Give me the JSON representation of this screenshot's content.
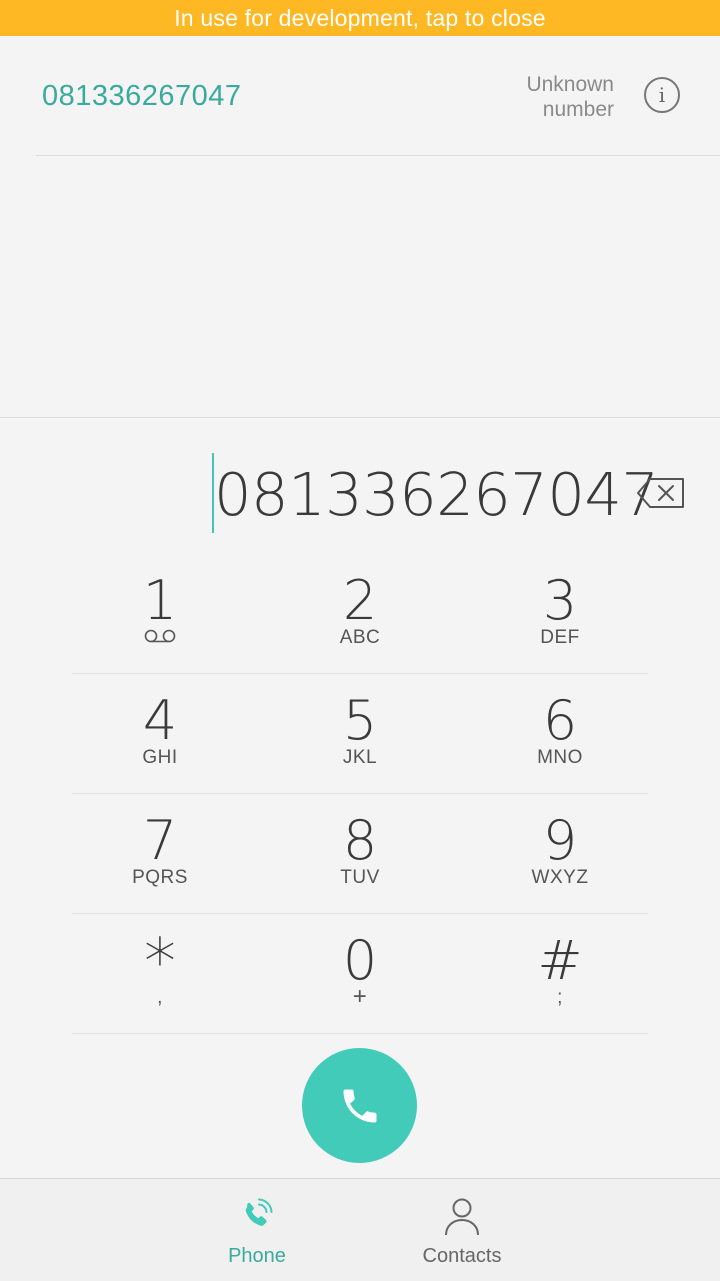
{
  "banner": {
    "text": "In use for development, tap to close"
  },
  "suggestion": {
    "number": "081336267047",
    "label_line1": "Unknown",
    "label_line2": "number",
    "info_glyph": "i"
  },
  "dialer": {
    "dialed_number": "081336267047"
  },
  "keypad": {
    "rows": [
      [
        {
          "digit": "1",
          "letters": ""
        },
        {
          "digit": "2",
          "letters": "ABC"
        },
        {
          "digit": "3",
          "letters": "DEF"
        }
      ],
      [
        {
          "digit": "4",
          "letters": "GHI"
        },
        {
          "digit": "5",
          "letters": "JKL"
        },
        {
          "digit": "6",
          "letters": "MNO"
        }
      ],
      [
        {
          "digit": "7",
          "letters": "PQRS"
        },
        {
          "digit": "8",
          "letters": "TUV"
        },
        {
          "digit": "9",
          "letters": "WXYZ"
        }
      ],
      [
        {
          "digit": "*",
          "letters": ","
        },
        {
          "digit": "0",
          "letters": "+"
        },
        {
          "digit": "#",
          "letters": ";"
        }
      ]
    ],
    "voicemail_icon": "voicemail-icon"
  },
  "nav": {
    "phone_label": "Phone",
    "contacts_label": "Contacts"
  },
  "colors": {
    "banner": "#fdb823",
    "accent": "#42cbb8",
    "accent_text": "#3aaa9c",
    "background": "#f4f4f4"
  }
}
